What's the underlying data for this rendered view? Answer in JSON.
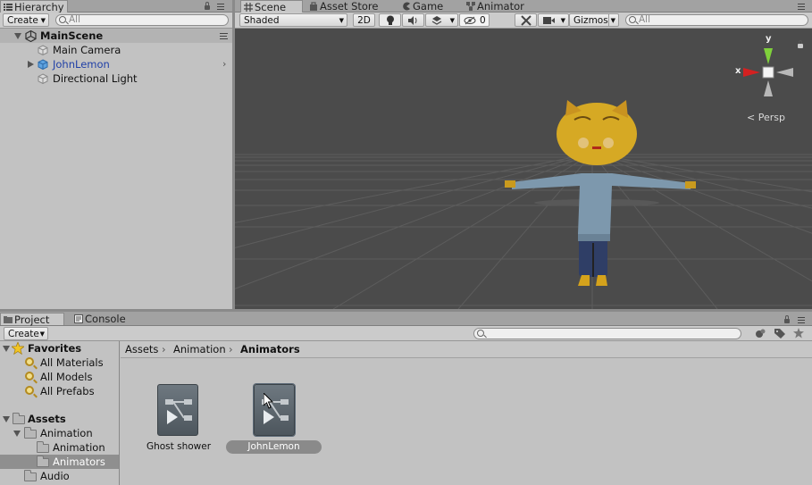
{
  "hierarchy": {
    "tab_label": "Hierarchy",
    "create_label": "Create",
    "search_placeholder": "All",
    "scene_name": "MainScene",
    "items": [
      {
        "label": "Main Camera",
        "color": "#111111"
      },
      {
        "label": "JohnLemon",
        "color": "#1f3fa6"
      },
      {
        "label": "Directional Light",
        "color": "#111111"
      }
    ]
  },
  "scene": {
    "tabs": [
      "Scene",
      "Asset Store",
      "Game",
      "Animator"
    ],
    "shading_mode": "Shaded",
    "btn_2d": "2D",
    "hidden_count": "0",
    "gizmos_label": "Gizmos",
    "search_placeholder": "All",
    "gizmo_axis_y": "y",
    "gizmo_axis_x": "x",
    "projection_label": "Persp",
    "background_color": "#4b4b4b"
  },
  "project": {
    "tabs": [
      "Project",
      "Console"
    ],
    "create_label": "Create",
    "favorites": {
      "title": "Favorites",
      "items": [
        "All Materials",
        "All Models",
        "All Prefabs"
      ]
    },
    "assets": {
      "title": "Assets",
      "animation_folder": "Animation",
      "subfolders": [
        "Animation",
        "Animators"
      ],
      "audio_folder": "Audio"
    },
    "breadcrumb": [
      "Assets",
      "Animation",
      "Animators"
    ],
    "files": [
      {
        "label": "Ghost shower",
        "selected": false
      },
      {
        "label": "JohnLemon",
        "selected": true
      }
    ]
  }
}
